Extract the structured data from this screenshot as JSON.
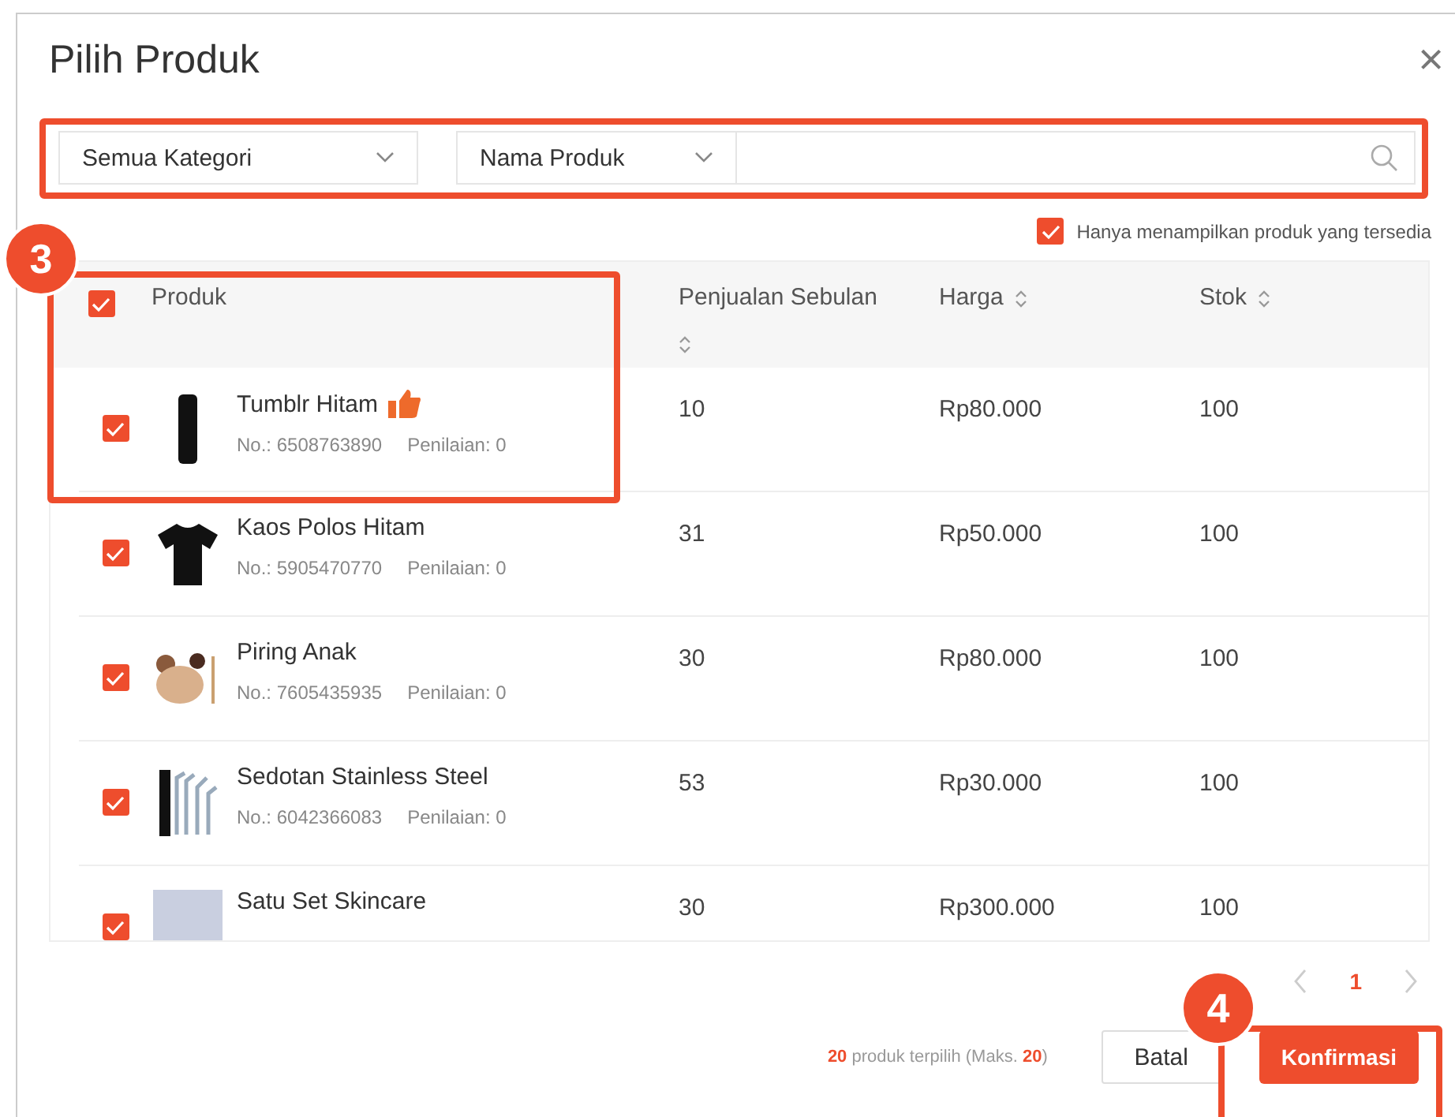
{
  "dialog": {
    "title": "Pilih Produk",
    "close": "×"
  },
  "filters": {
    "category": "Semua Kategori",
    "field": "Nama Produk"
  },
  "available_only": {
    "label": "Hanya menampilkan produk yang tersedia",
    "checked": true
  },
  "table": {
    "select_all": {
      "checked": true
    },
    "columns": [
      {
        "label": "Produk",
        "sortable": false
      },
      {
        "label": "Penjualan Sebulan",
        "sortable": true
      },
      {
        "label": "Harga",
        "sortable": true
      },
      {
        "label": "Stok",
        "sortable": true
      }
    ],
    "rows": [
      {
        "checked": true,
        "kind": "tumbler",
        "name": "Tumblr Hitam",
        "recommended": true,
        "number": "No.: 6508763890",
        "rating": "Penilaian: 0",
        "sales": "10",
        "price": "Rp80.000",
        "stock": "100"
      },
      {
        "checked": true,
        "kind": "tshirt",
        "name": "Kaos Polos Hitam",
        "recommended": false,
        "number": "No.: 5905470770",
        "rating": "Penilaian: 0",
        "sales": "31",
        "price": "Rp50.000",
        "stock": "100"
      },
      {
        "checked": true,
        "kind": "plate",
        "name": "Piring Anak",
        "recommended": false,
        "number": "No.: 7605435935",
        "rating": "Penilaian: 0",
        "sales": "30",
        "price": "Rp80.000",
        "stock": "100"
      },
      {
        "checked": true,
        "kind": "straws",
        "name": "Sedotan Stainless Steel",
        "recommended": false,
        "number": "No.: 6042366083",
        "rating": "Penilaian: 0",
        "sales": "53",
        "price": "Rp30.000",
        "stock": "100"
      },
      {
        "checked": true,
        "kind": "photo",
        "name": "Satu Set Skincare",
        "recommended": false,
        "sales": "30",
        "price": "Rp300.000",
        "stock": "100"
      }
    ]
  },
  "pagination": {
    "pages": [
      {
        "label": "1",
        "selected": true
      }
    ]
  },
  "footer": {
    "count": "20",
    "text": "produk terpilih (Maks.",
    "max": "20",
    "closing": ")",
    "cancel": "Batal",
    "confirm": "Konfirmasi"
  },
  "callouts": [
    {
      "label": "3"
    },
    {
      "label": "4"
    }
  ]
}
